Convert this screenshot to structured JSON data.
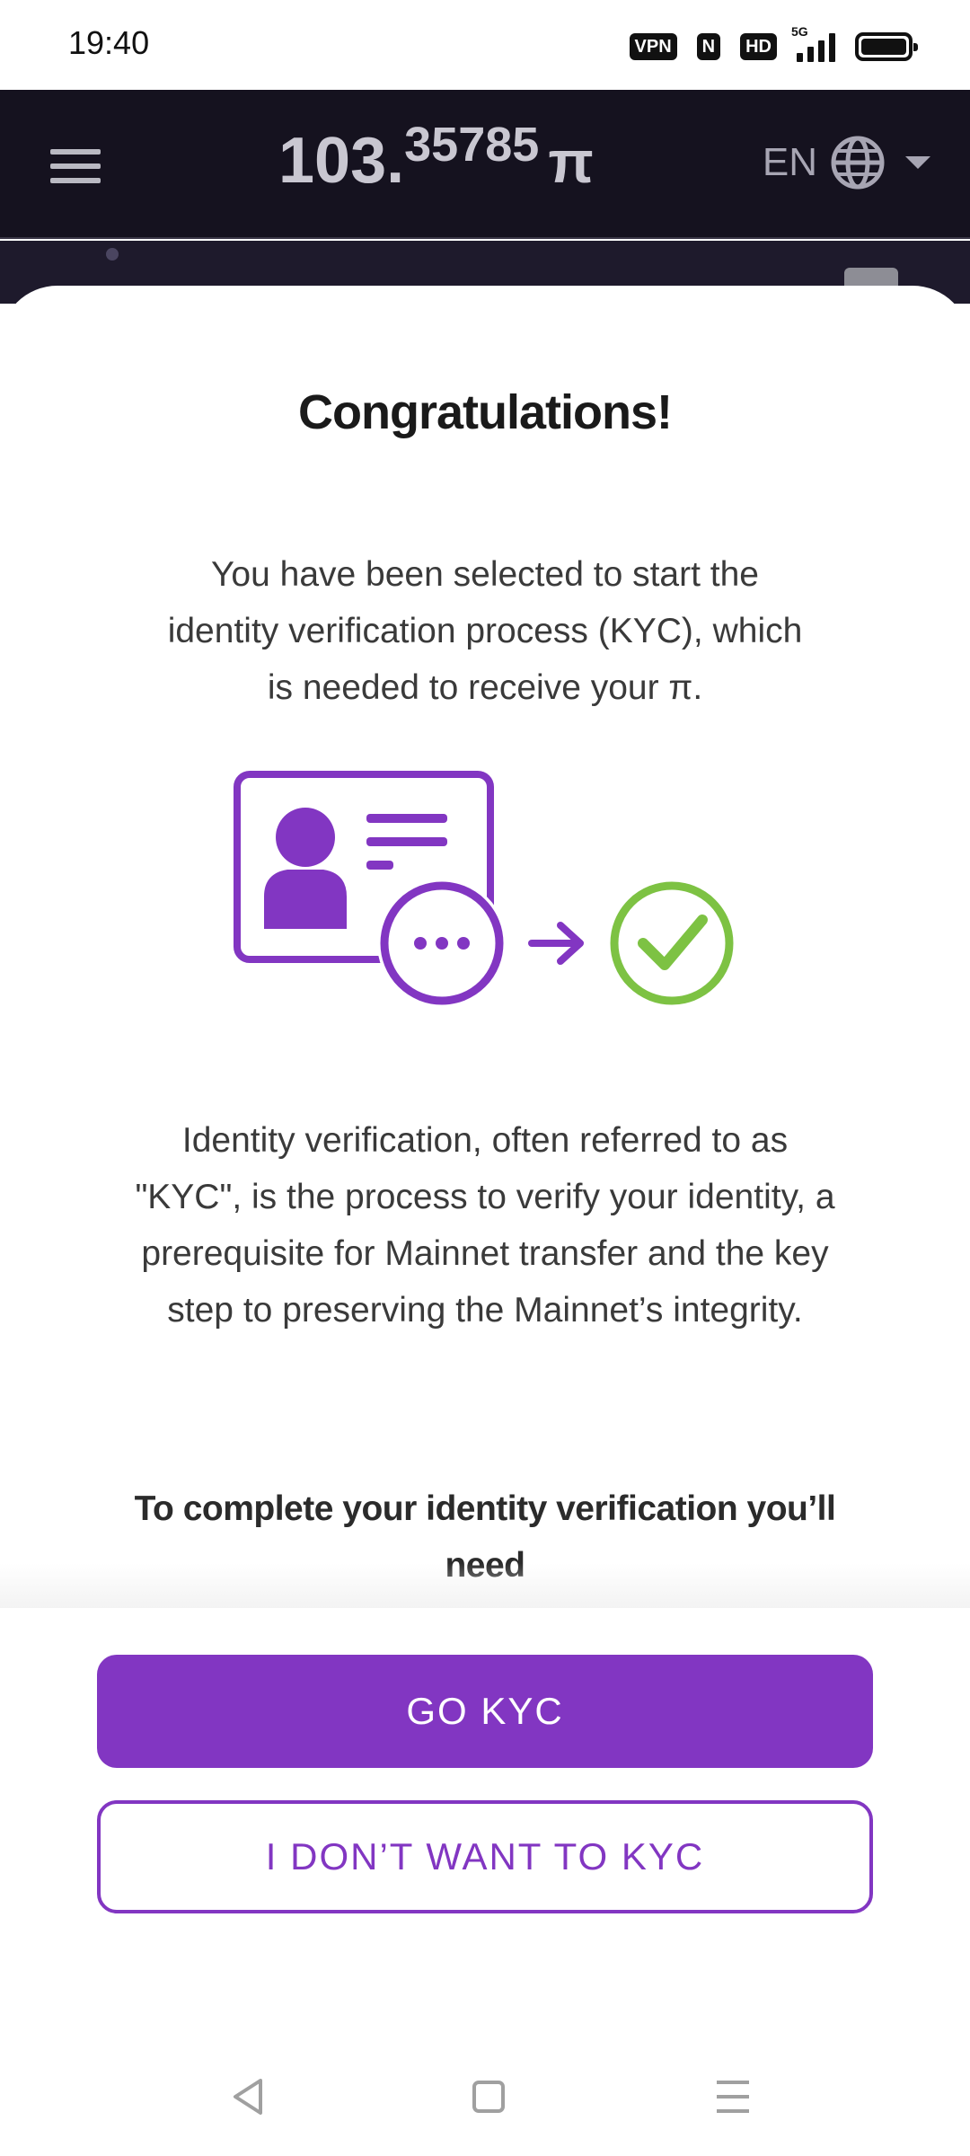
{
  "status_bar": {
    "time": "19:40",
    "vpn": "VPN",
    "nfc": "N",
    "hd": "HD",
    "network": "5G",
    "battery_level": 0.9
  },
  "header": {
    "balance_integer": "103.",
    "balance_decimal": "35785",
    "currency_symbol": "π",
    "language": "EN"
  },
  "sheet": {
    "title": "Congratulations!",
    "intro": "You have been selected to start the identity verification process (KYC), which is needed to receive your π.",
    "explanation": "Identity verification, often referred to as \"KYC\", is the process to verify your identity, a prerequisite for Mainnet transfer and the key step to preserving the Mainnet’s integrity.",
    "requirements_heading": "To complete your identity verification you’ll need"
  },
  "actions": {
    "primary_label": "GO KYC",
    "secondary_label": "I DON’T WANT TO KYC"
  },
  "colors": {
    "accent": "#8236c2",
    "success": "#7dc243",
    "header_bg": "#15121f"
  }
}
